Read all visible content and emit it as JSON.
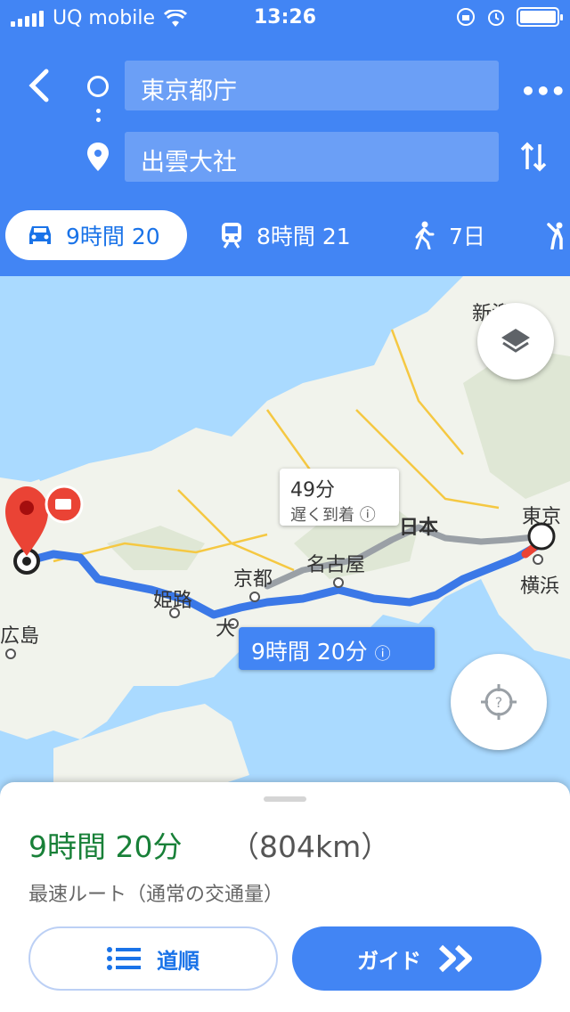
{
  "status": {
    "carrier": "UQ mobile",
    "time": "13:26"
  },
  "search": {
    "origin": "東京都庁",
    "destination": "出雲大社"
  },
  "modes": [
    {
      "name": "car",
      "label": "9時間 20",
      "selected": true
    },
    {
      "name": "train",
      "label": "8時間 21"
    },
    {
      "name": "walk",
      "label": "7日"
    },
    {
      "name": "ride",
      "label": ""
    }
  ],
  "map": {
    "cities": {
      "niigata": "新潟",
      "tokyo": "東京",
      "yokohama": "横浜",
      "nagoya": "名古屋",
      "kyoto": "京都",
      "himeji": "姫路",
      "osaka": "大",
      "hiroshima": "広島",
      "nihon": "日本"
    },
    "alt_route": {
      "time": "49分",
      "note": "遅く到着"
    },
    "main_route": {
      "time": "9時間 20分"
    },
    "colors": {
      "route": "#4285f4",
      "alt_route": "#9aa0a6",
      "pin": "#ea4335"
    }
  },
  "sheet": {
    "duration": "9時間 20分",
    "distance": "（804km）",
    "route_desc": "最速ルート（通常の交通量）",
    "steps_label": "道順",
    "guide_label": "ガイド"
  }
}
